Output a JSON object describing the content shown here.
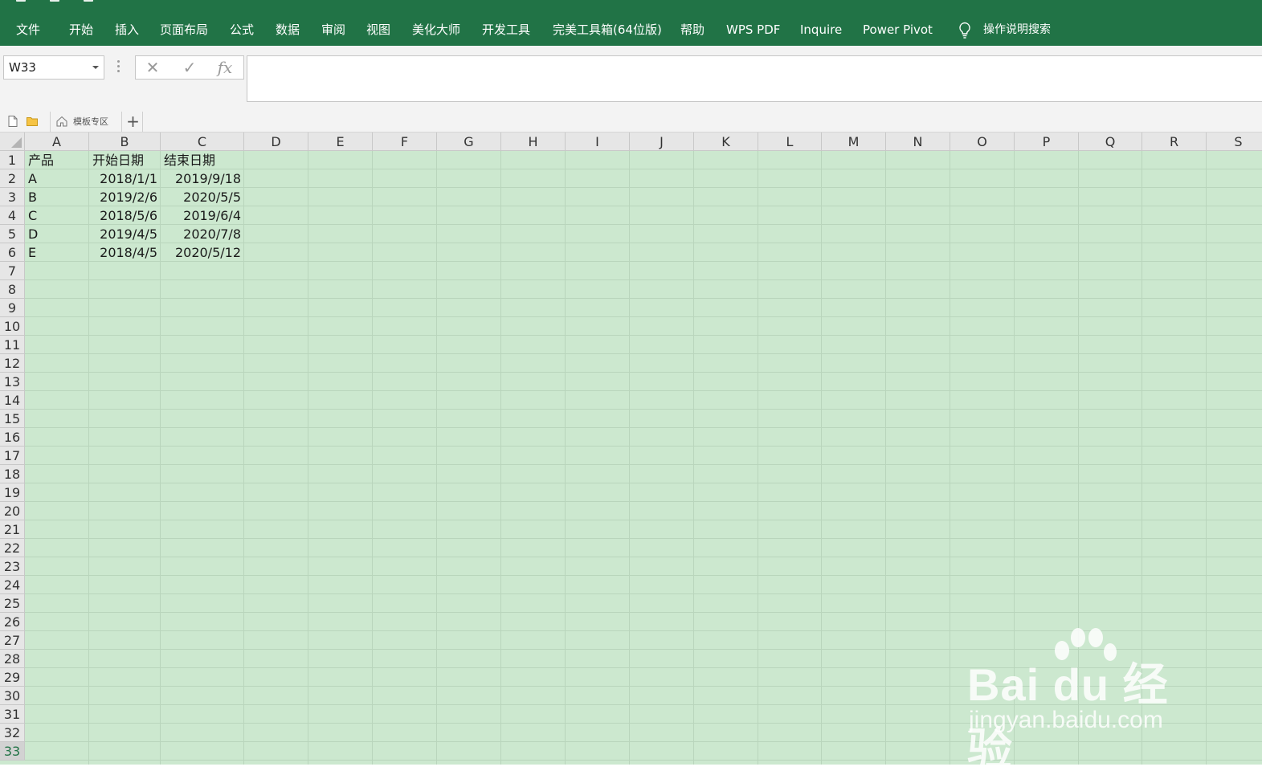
{
  "ribbon": {
    "menu": [
      "文件",
      "开始",
      "插入",
      "页面布局",
      "公式",
      "数据",
      "审阅",
      "视图",
      "美化大师",
      "开发工具",
      "完美工具箱(64位版)",
      "帮助",
      "WPS PDF",
      "Inquire",
      "Power Pivot"
    ],
    "tell_me": "操作说明搜索",
    "accent_color": "#217346"
  },
  "formula_bar": {
    "name_box": "W33",
    "cancel_icon": "✕",
    "confirm_icon": "✓",
    "fx_label": "fx",
    "formula": ""
  },
  "tabstrip": {
    "template_tab": "模板专区",
    "add_tab": "+"
  },
  "sheet": {
    "columns": [
      "A",
      "B",
      "C",
      "D",
      "E",
      "F",
      "G",
      "H",
      "I",
      "J",
      "K",
      "L",
      "M",
      "N",
      "O",
      "P",
      "Q",
      "R",
      "S"
    ],
    "row_numbers": [
      "1",
      "2",
      "3",
      "4",
      "5",
      "6",
      "7",
      "8",
      "9",
      "10",
      "11",
      "12",
      "13",
      "14",
      "15",
      "16",
      "17",
      "18",
      "19",
      "20",
      "21",
      "22",
      "23",
      "24",
      "25",
      "26",
      "27",
      "28",
      "29",
      "30",
      "31",
      "32",
      "33"
    ],
    "active_row": "33",
    "cells": [
      [
        "产品",
        "开始日期",
        "结束日期"
      ],
      [
        "A",
        "2018/1/1",
        "2019/9/18"
      ],
      [
        "B",
        "2019/2/6",
        "2020/5/5"
      ],
      [
        "C",
        "2018/5/6",
        "2019/6/4"
      ],
      [
        "D",
        "2019/4/5",
        "2020/7/8"
      ],
      [
        "E",
        "2018/4/5",
        "2020/5/12"
      ]
    ],
    "background_color": "#cce8cf"
  },
  "watermark": {
    "brand": "Bai du 经验",
    "url": "jingyan.baidu.com"
  }
}
